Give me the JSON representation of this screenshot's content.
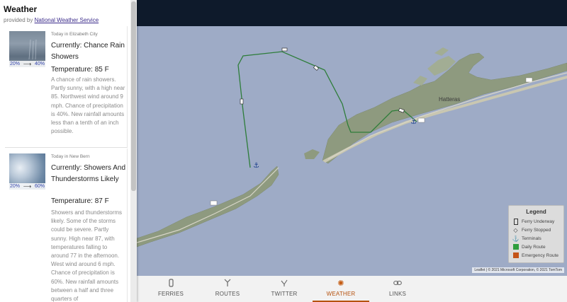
{
  "sidebar": {
    "title": "Weather",
    "provided_prefix": "provided by",
    "provider_link": "National Weather Service",
    "forecasts": [
      {
        "place": "Today in Elizabeth City",
        "currently": "Currently: Chance Rain Showers",
        "temperature": "Temperature: 85 F",
        "pct_from": "20%",
        "pct_to": "40%",
        "description": "A chance of rain showers. Partly sunny, with a high near 85. Northwest wind around 9 mph. Chance of precipitation is 40%. New rainfall amounts less than a tenth of an inch possible."
      },
      {
        "place": "Today in New Bern",
        "currently": "Currently: Showers And Thunderstorms Likely",
        "temperature": "Temperature: 87 F",
        "pct_from": "20%",
        "pct_to": "60%",
        "description": "Showers and thunderstorms likely. Some of the storms could be severe. Partly sunny. High near 87, with temperatures falling to around 77 in the afternoon. West wind around 6 mph. Chance of precipitation is 60%. New rainfall amounts between a half and three quarters of"
      }
    ]
  },
  "map": {
    "place_label": "Hatteras",
    "route_shield_1": "12",
    "route_shield_2": "12",
    "route_shield_3": "12",
    "attribution": "Leaflet | © 2021 Microsoft Corporation, © 2021 TomTom"
  },
  "legend": {
    "title": "Legend",
    "items": [
      {
        "label": "Ferry Underway",
        "icon": "ferry-underway-icon"
      },
      {
        "label": "Ferry Stopped",
        "icon": "ferry-stopped-icon"
      },
      {
        "label": "Terminals",
        "icon": "anchor-icon"
      },
      {
        "label": "Daily Route",
        "color": "#2e9e3e"
      },
      {
        "label": "Emergency Route",
        "color": "#c4541a"
      }
    ]
  },
  "nav": {
    "items": [
      {
        "label": "FERRIES",
        "icon": "ferry-icon"
      },
      {
        "label": "ROUTES",
        "icon": "routes-icon"
      },
      {
        "label": "TWITTER",
        "icon": "twitter-icon"
      },
      {
        "label": "WEATHER",
        "icon": "sun-icon",
        "active": true
      },
      {
        "label": "LINKS",
        "icon": "link-icon"
      }
    ]
  },
  "colors": {
    "accent": "#b5520f",
    "water": "#9eabc6",
    "land": "#8f9b7e",
    "topbar": "#0e1a2b"
  }
}
